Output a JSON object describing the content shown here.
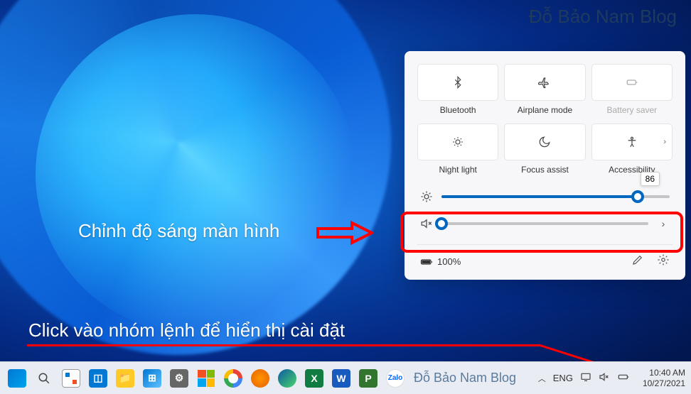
{
  "watermark": "Đỗ Bảo Nam Blog",
  "annotations": {
    "brightness_label": "Chỉnh độ sáng màn hình",
    "click_label": "Click vào nhóm lệnh để hiển thị cài đặt"
  },
  "quick_settings": {
    "tiles": [
      {
        "id": "bluetooth",
        "label": "Bluetooth",
        "icon": "bluetooth-icon",
        "disabled": false,
        "chevron": false
      },
      {
        "id": "airplane",
        "label": "Airplane mode",
        "icon": "airplane-icon",
        "disabled": false,
        "chevron": false
      },
      {
        "id": "battery-saver",
        "label": "Battery saver",
        "icon": "battery-saver-icon",
        "disabled": true,
        "chevron": false
      },
      {
        "id": "night-light",
        "label": "Night light",
        "icon": "night-light-icon",
        "disabled": false,
        "chevron": false
      },
      {
        "id": "focus-assist",
        "label": "Focus assist",
        "icon": "focus-assist-icon",
        "disabled": false,
        "chevron": false
      },
      {
        "id": "accessibility",
        "label": "Accessibility",
        "icon": "accessibility-icon",
        "disabled": false,
        "chevron": true
      }
    ],
    "brightness": {
      "value": 86,
      "tooltip": "86"
    },
    "volume": {
      "value": 0
    },
    "battery_status": "100%"
  },
  "taskbar": {
    "text": "Đỗ Bảo Nam Blog",
    "lang": "ENG",
    "time": "10:40 AM",
    "date": "10/27/2021",
    "apps": [
      "start",
      "search",
      "task-view",
      "widgets",
      "explorer",
      "store",
      "settings",
      "office",
      "chrome",
      "firefox",
      "edge",
      "excel",
      "word",
      "project",
      "zalo"
    ]
  }
}
